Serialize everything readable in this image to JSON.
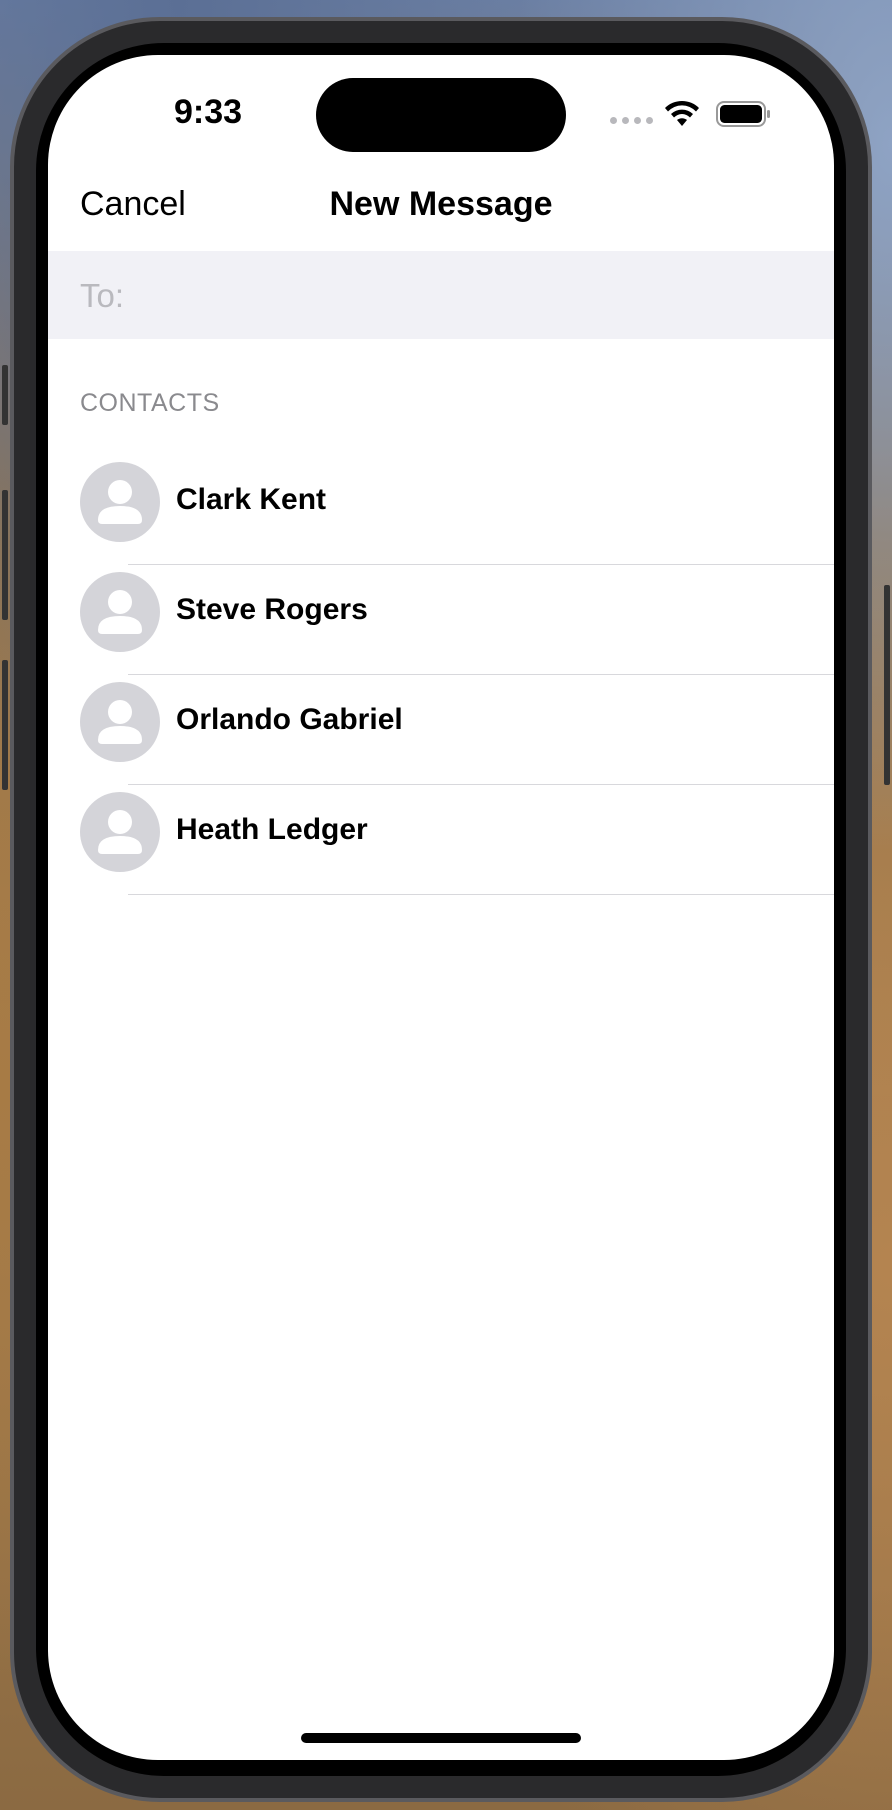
{
  "status_bar": {
    "time": "9:33",
    "icons": [
      "signal-icon",
      "wifi-icon",
      "battery-icon"
    ]
  },
  "nav": {
    "cancel_label": "Cancel",
    "title": "New Message"
  },
  "to_field": {
    "label": "To:",
    "value": "",
    "placeholder": ""
  },
  "contacts": {
    "header": "CONTACTS",
    "items": [
      {
        "name": "Clark Kent",
        "icon": "person-placeholder-icon"
      },
      {
        "name": "Steve Rogers",
        "icon": "person-placeholder-icon"
      },
      {
        "name": "Orlando Gabriel",
        "icon": "person-placeholder-icon"
      },
      {
        "name": "Heath Ledger",
        "icon": "person-placeholder-icon"
      }
    ]
  },
  "colors": {
    "avatar_bg": "#d4d4d9",
    "to_field_bg": "#f1f1f6",
    "section_header": "#8a8a8e"
  }
}
